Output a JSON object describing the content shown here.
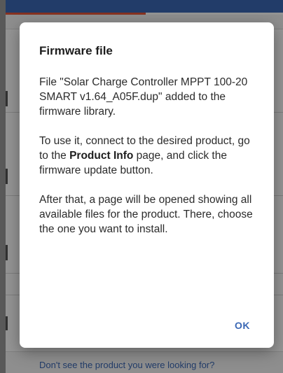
{
  "background": {
    "footer_link": "Don't see the product you were looking for?"
  },
  "dialog": {
    "title": "Firmware file",
    "paragraph1": "File \"Solar Charge Controller MPPT 100-20 SMART v1.64_A05F.dup\" added to the firmware library.",
    "paragraph2_before": "To use it, connect to the desired product, go to the ",
    "paragraph2_bold": "Product Info",
    "paragraph2_after": " page, and click the firmware update button.",
    "paragraph3": "After that, a page will be opened showing all available files for the product. There, choose the one you want to install.",
    "ok_label": "OK"
  },
  "colors": {
    "accent": "#3b68b5",
    "progress": "#e8563a",
    "dialog_bg": "#ffffff",
    "scrim": "#000000"
  }
}
